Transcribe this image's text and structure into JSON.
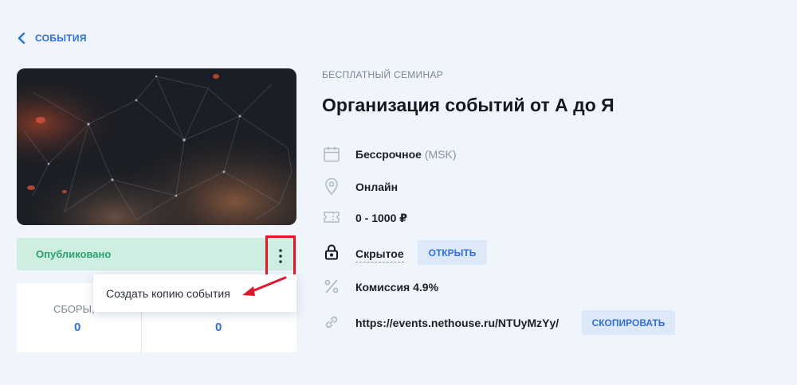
{
  "nav": {
    "back_label": "СОБЫТИЯ"
  },
  "status": {
    "label": "Опубликовано",
    "menu_icon": "kebab-vertical-icon"
  },
  "dropdown": {
    "items": [
      {
        "label": "Создать копию события"
      }
    ]
  },
  "stats": {
    "left": {
      "label": "СБОРЫ,",
      "value": "0"
    },
    "right": {
      "label": "",
      "value": "0"
    }
  },
  "event": {
    "type": "БЕСПЛАТНЫЙ СЕМИНАР",
    "title": "Организация событий от А до Я",
    "schedule": {
      "label": "Бессрочное",
      "timezone": "(MSK)",
      "icon": "calendar-icon"
    },
    "location": {
      "label": "Онлайн",
      "icon": "map-pin-icon"
    },
    "price": {
      "label": "0 - 1000 ₽",
      "icon": "ticket-icon"
    },
    "visibility": {
      "label": "Скрытое",
      "action": "ОТКРЫТЬ",
      "icon": "lock-icon"
    },
    "commission": {
      "label": "Комиссия 4.9%",
      "icon": "percent-icon"
    },
    "link": {
      "url": "https://events.nethouse.ru/NTUyMzYy/",
      "action": "СКОПИРОВАТЬ",
      "icon": "link-icon"
    }
  },
  "colors": {
    "accent": "#2f6fd9",
    "status_bg": "#cfeee2",
    "status_text": "#2aa26e",
    "highlight": "#e0172a",
    "page_bg": "#f0f5fb"
  }
}
